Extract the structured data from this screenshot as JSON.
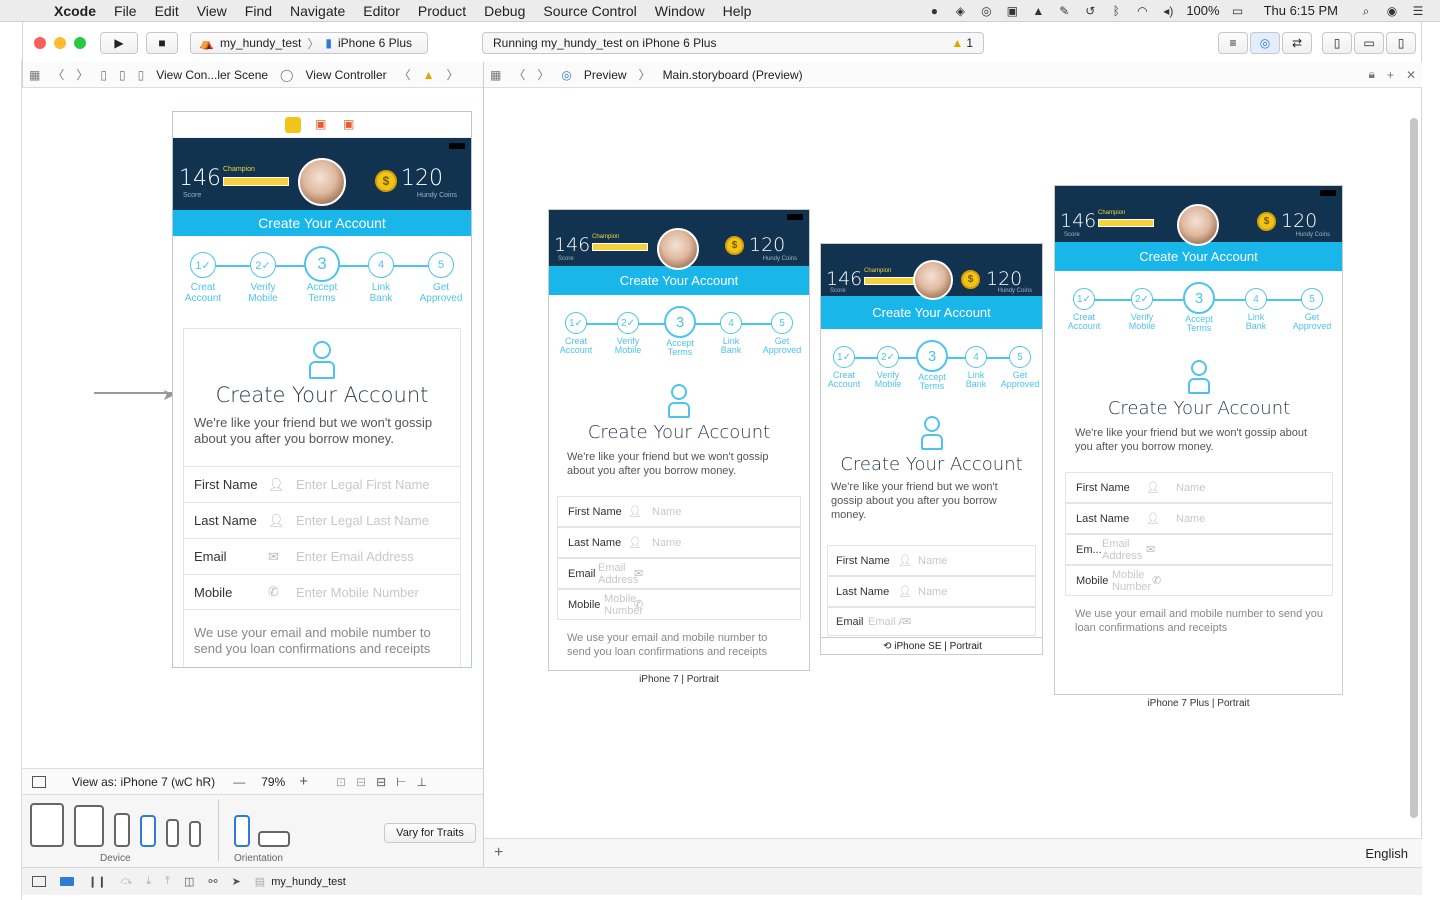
{
  "menubar": {
    "app": "Xcode",
    "items": [
      "File",
      "Edit",
      "View",
      "Find",
      "Navigate",
      "Editor",
      "Product",
      "Debug",
      "Source Control",
      "Window",
      "Help"
    ],
    "battery": "100%",
    "clock": "Thu 6:15 PM"
  },
  "toolbar": {
    "scheme": "my_hundy_test",
    "device": "iPhone 6 Plus",
    "activity": "Running my_hundy_test on iPhone 6 Plus",
    "warnings": "1"
  },
  "jumpbar_left": {
    "scene": "View Con...ler Scene",
    "controller": "View Controller"
  },
  "jumpbar_right": {
    "preview": "Preview",
    "file": "Main.storyboard (Preview)"
  },
  "app": {
    "score": "146",
    "score_label": "Score",
    "rank": "Champion",
    "coins": "120",
    "coins_label": "Hundy Coins",
    "banner": "Create Your Account",
    "steps": [
      {
        "n": "1✓",
        "l1": "Creat",
        "l2": "Account"
      },
      {
        "n": "2✓",
        "l1": "Verify",
        "l2": "Mobile"
      },
      {
        "n": "3",
        "l1": "Accept",
        "l2": "Terms"
      },
      {
        "n": "4",
        "l1": "Link",
        "l2": "Bank"
      },
      {
        "n": "5",
        "l1": "Get",
        "l2": "Approved"
      }
    ],
    "card_title": "Create Your Account",
    "card_text": "We're like your friend but we won't gossip about you after you borrow money.",
    "fields": [
      {
        "label": "First Name",
        "placeholder": "Enter Legal First Name"
      },
      {
        "label": "Last Name",
        "placeholder": "Enter Legal Last Name"
      },
      {
        "label": "Email",
        "placeholder": "Enter Email Address"
      },
      {
        "label": "Mobile",
        "placeholder": "Enter Mobile Number"
      }
    ],
    "footer_note": "We use your email and mobile number to send you loan confirmations and receipts"
  },
  "previews": {
    "p7": {
      "caption": "iPhone 7 | Portrait",
      "fields": [
        "First Name",
        "Last Name",
        "Email",
        "Mobile"
      ],
      "ph": [
        "Name",
        "Name",
        "Email Address",
        "Mobile Number"
      ]
    },
    "pse": {
      "caption": "iPhone SE | Portrait",
      "fields": [
        "First Name",
        "Last Name",
        "Email"
      ],
      "ph": [
        "Name",
        "Name",
        "Email Address"
      ]
    },
    "p7plus": {
      "caption": "iPhone 7 Plus | Portrait",
      "fields": [
        "First Name",
        "Last Name",
        "Em...",
        "Mobile"
      ],
      "ph": [
        "Name",
        "Name",
        "Email Address",
        "Mobile Number"
      ]
    }
  },
  "se_card_text": "We're like your friend but we won't gossip about you after you borrow money.",
  "bottom": {
    "view_as": "View as: iPhone 7 (wC hR)",
    "zoom": "79%",
    "vary": "Vary for Traits",
    "device_label": "Device",
    "orientation_label": "Orientation"
  },
  "preview_lang": "English",
  "status": {
    "target": "my_hundy_test"
  },
  "colors": {
    "navy": "#11334f",
    "cyan": "#19b6ea",
    "step": "#4fc3ef",
    "gold": "#f5d13b"
  }
}
